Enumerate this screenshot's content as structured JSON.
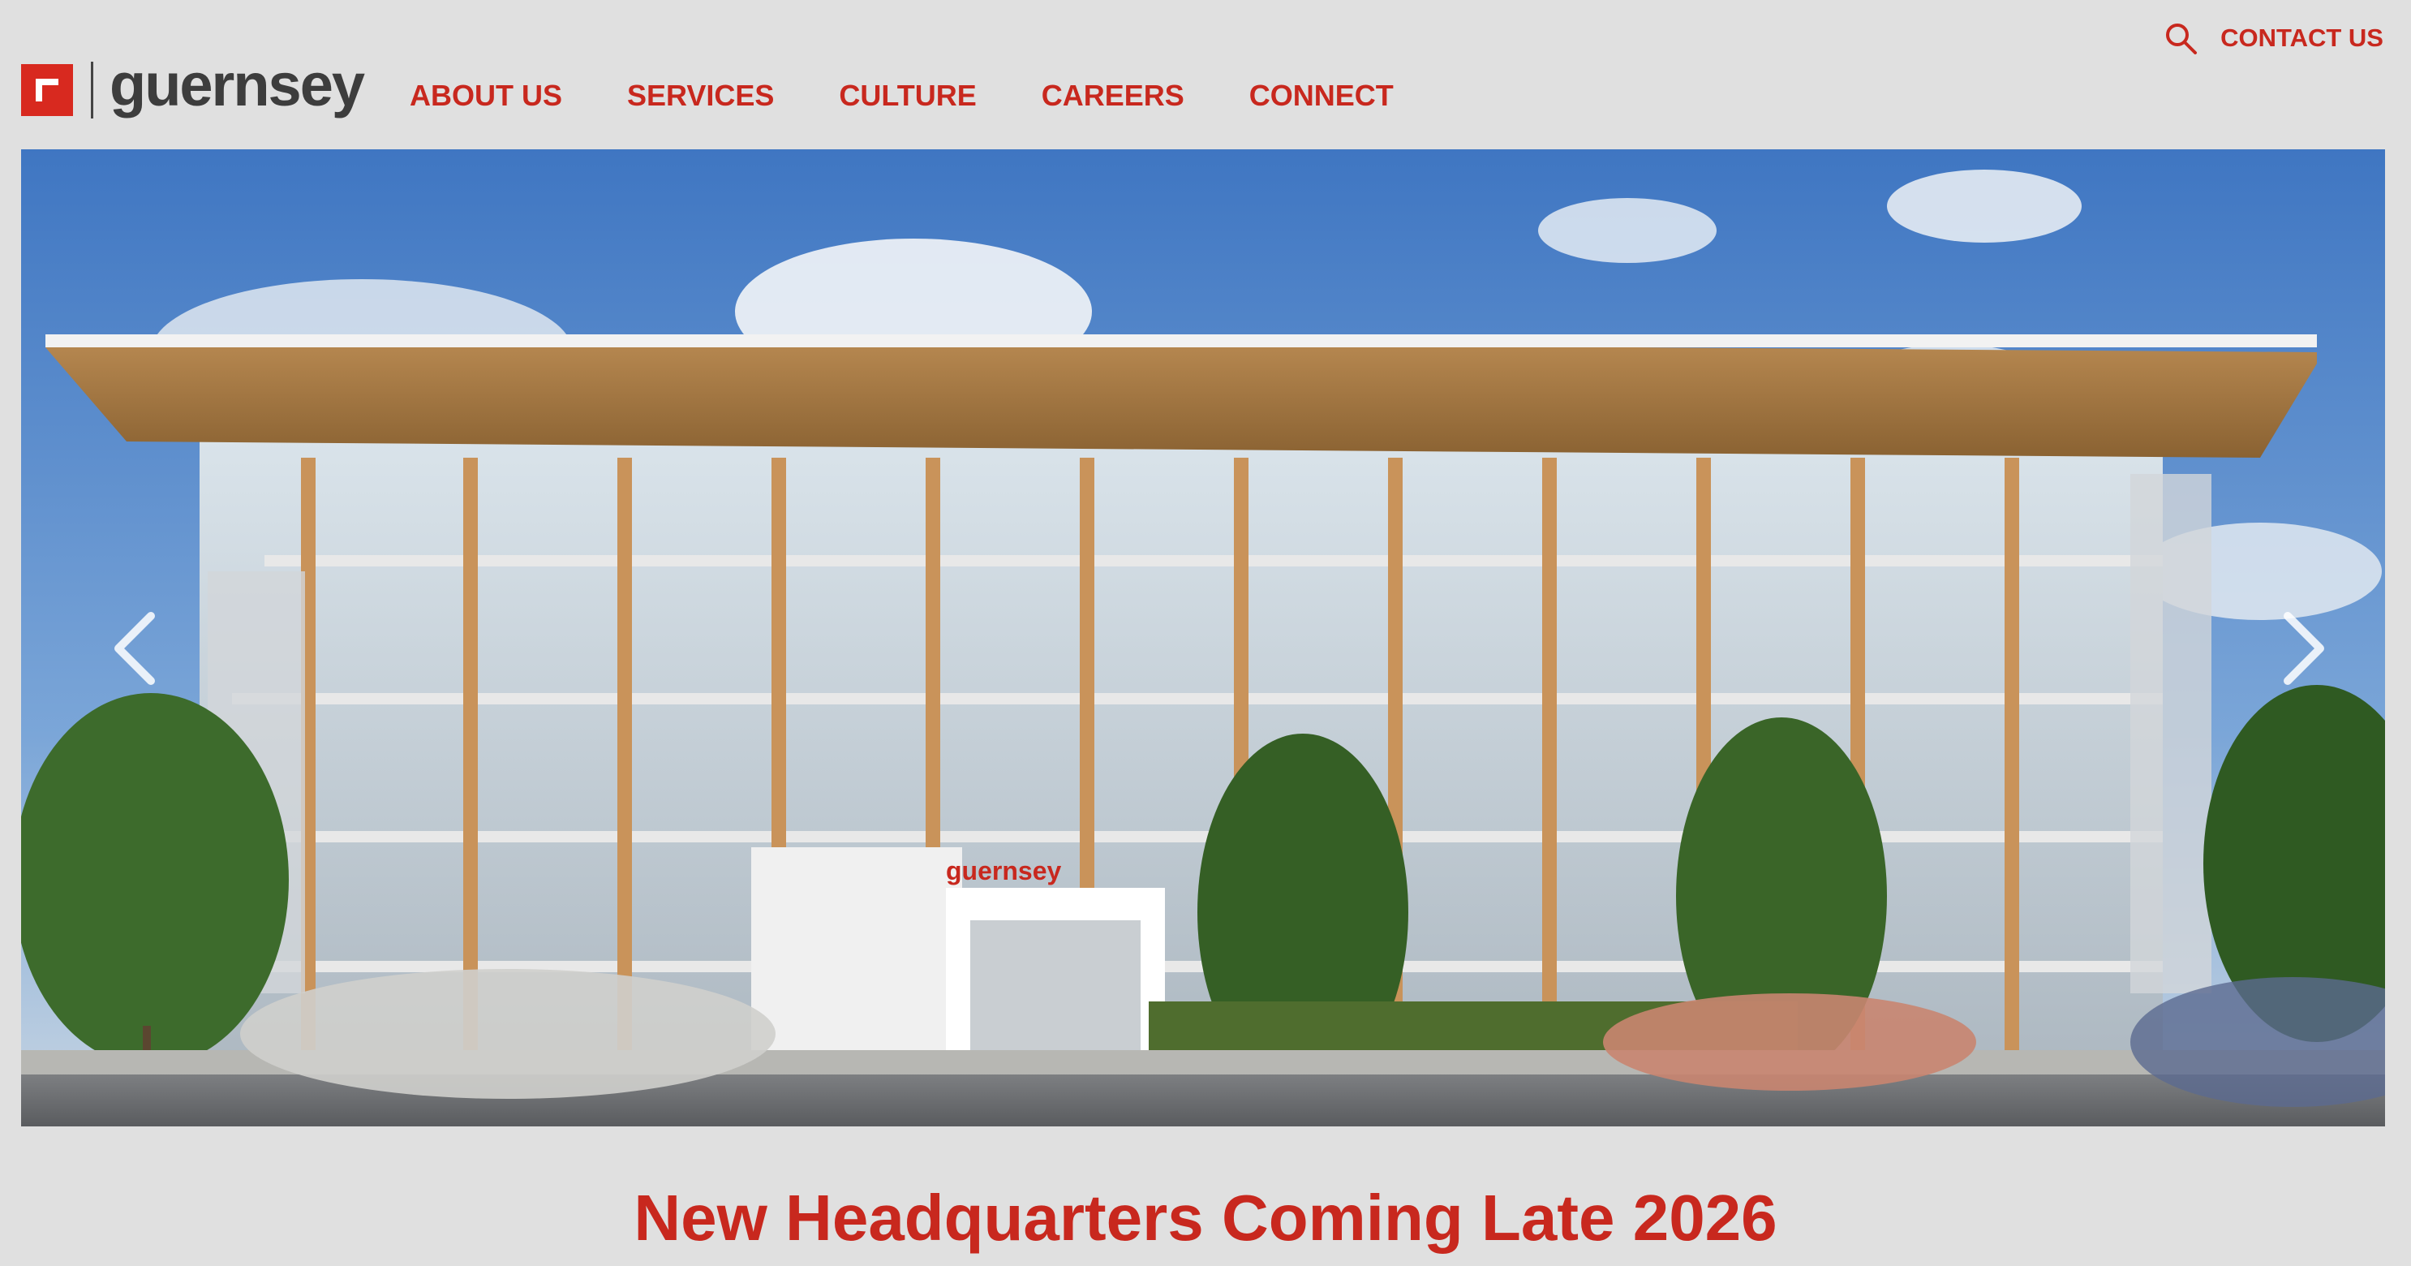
{
  "brand": {
    "name": "guernsey"
  },
  "nav": {
    "items": [
      "ABOUT US",
      "SERVICES",
      "CULTURE",
      "CAREERS",
      "CONNECT"
    ]
  },
  "utility": {
    "contact_label": "CONTACT US",
    "search_icon": "search-icon"
  },
  "hero": {
    "image": "rendering of a four-story glass and timber office building",
    "building_sign": "guernsey",
    "prev_icon": "chevron-left-icon",
    "next_icon": "chevron-right-icon"
  },
  "headline": "New Headquarters Coming Late 2026",
  "colors": {
    "accent": "#c8281e",
    "logo_red": "#d8291f",
    "background": "#e0e0e0",
    "text_dark": "#3d3d3d"
  }
}
